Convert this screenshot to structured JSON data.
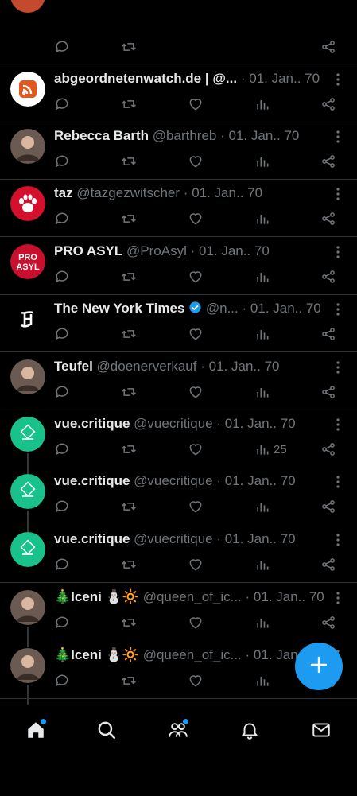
{
  "colors": {
    "accent": "#1d9bf0",
    "background": "#000000",
    "text": "#e7e9ea",
    "muted": "#71767b",
    "divider": "#2f3336",
    "verified": "#1d9bf0"
  },
  "separator": "·",
  "tweets": [
    {
      "name": "abgeordnetenwatch.de | @...",
      "handle": "",
      "date": "01. Jan.. 70",
      "avatar": "abgeordnetenwatch-logo",
      "views": ""
    },
    {
      "name": "Rebecca Barth",
      "handle": "@barthreb",
      "date": "01. Jan.. 70",
      "avatar": "person-photo",
      "views": ""
    },
    {
      "name": "taz",
      "handle": "@tazgezwitscher",
      "date": "01. Jan.. 70",
      "avatar": "taz-paw-logo",
      "views": ""
    },
    {
      "name": "PRO ASYL",
      "handle": "@ProAsyl",
      "date": "01. Jan.. 70",
      "avatar": "pro-asyl-logo",
      "views": "",
      "avatar_text": [
        "PRO",
        "ASYL"
      ]
    },
    {
      "name": "The New York Times",
      "handle": "@n...",
      "date": "01. Jan.. 70",
      "avatar": "nyt-logo",
      "views": "",
      "verified": true
    },
    {
      "name": "Teufel",
      "handle": "@doenerverkauf",
      "date": "01. Jan.. 70",
      "avatar": "person-photo",
      "views": ""
    },
    {
      "name": "vue.critique",
      "handle": "@vuecritique",
      "date": "01. Jan.. 70",
      "avatar": "vue-critique-logo",
      "views": "25"
    },
    {
      "name": "vue.critique",
      "handle": "@vuecritique",
      "date": "01. Jan.. 70",
      "avatar": "vue-critique-logo",
      "views": ""
    },
    {
      "name": "vue.critique",
      "handle": "@vuecritique",
      "date": "01. Jan.. 70",
      "avatar": "vue-critique-logo",
      "views": ""
    },
    {
      "name": "🎄Iceni ⛄🔆",
      "handle": "@queen_of_ic...",
      "date": "01. Jan.. 70",
      "avatar": "person-photo",
      "views": ""
    },
    {
      "name": "🎄Iceni ⛄🔆",
      "handle": "@queen_of_ic...",
      "date": "01. Jan..",
      "avatar": "person-photo",
      "views": ""
    }
  ],
  "fab": {
    "icon": "plus-icon"
  },
  "bottom_nav": [
    {
      "icon": "home-icon",
      "badge": true
    },
    {
      "icon": "search-icon",
      "badge": false
    },
    {
      "icon": "communities-icon",
      "badge": true
    },
    {
      "icon": "bell-icon",
      "badge": false
    },
    {
      "icon": "mail-icon",
      "badge": false
    }
  ]
}
